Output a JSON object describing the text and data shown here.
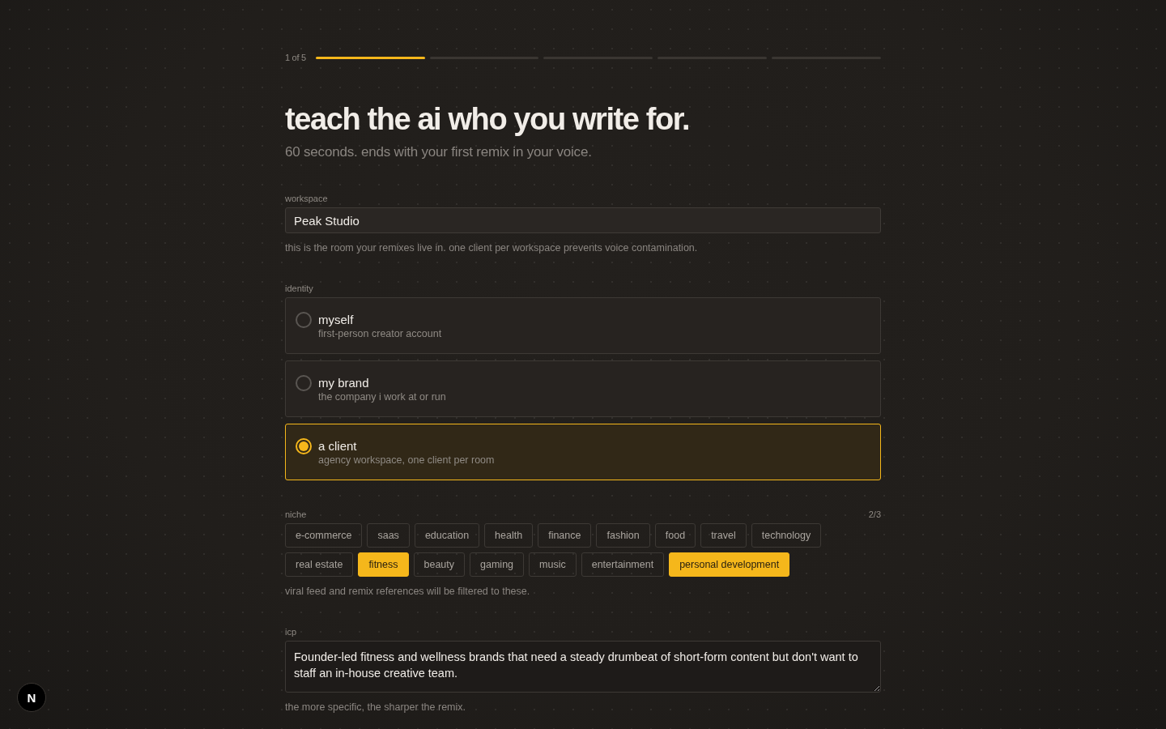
{
  "progress": {
    "label": "1 of 5",
    "steps": [
      {
        "done": true
      },
      {
        "done": false
      },
      {
        "done": false
      },
      {
        "done": false
      },
      {
        "done": false
      }
    ]
  },
  "heading": "teach the ai who you write for.",
  "subheading": "60 seconds. ends with your first remix in your voice.",
  "workspace": {
    "label": "workspace",
    "value": "Peak Studio",
    "hint": "this is the room your remixes live in. one client per workspace prevents voice contamination."
  },
  "identity": {
    "label": "identity",
    "options": [
      {
        "title": "myself",
        "description": "first-person creator account",
        "selected": false
      },
      {
        "title": "my brand",
        "description": "the company i work at or run",
        "selected": false
      },
      {
        "title": "a client",
        "description": "agency workspace, one client per room",
        "selected": true
      }
    ]
  },
  "niche": {
    "label": "niche",
    "count": "2/3",
    "options": [
      {
        "label": "e-commerce",
        "selected": false
      },
      {
        "label": "saas",
        "selected": false
      },
      {
        "label": "education",
        "selected": false
      },
      {
        "label": "health",
        "selected": false
      },
      {
        "label": "finance",
        "selected": false
      },
      {
        "label": "fashion",
        "selected": false
      },
      {
        "label": "food",
        "selected": false
      },
      {
        "label": "travel",
        "selected": false
      },
      {
        "label": "technology",
        "selected": false
      },
      {
        "label": "real estate",
        "selected": false
      },
      {
        "label": "fitness",
        "selected": true
      },
      {
        "label": "beauty",
        "selected": false
      },
      {
        "label": "gaming",
        "selected": false
      },
      {
        "label": "music",
        "selected": false
      },
      {
        "label": "entertainment",
        "selected": false
      },
      {
        "label": "personal development",
        "selected": true
      }
    ],
    "hint": "viral feed and remix references will be filtered to these."
  },
  "icp": {
    "label": "icp",
    "value": "Founder-led fitness and wellness brands that need a steady drumbeat of short-form content but don't want to staff an in-house creative team.",
    "hint": "the more specific, the sharper the remix."
  },
  "dev_badge": {
    "letter": "N"
  }
}
